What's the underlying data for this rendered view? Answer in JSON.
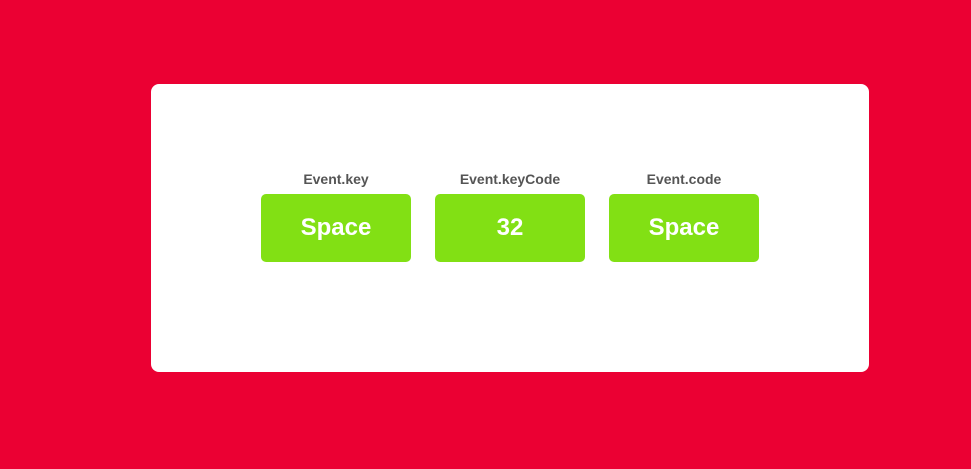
{
  "colors": {
    "background": "#eb0033",
    "card": "#ffffff",
    "key_box": "#82e014",
    "label_text": "#555555",
    "value_text": "#ffffff"
  },
  "keys": [
    {
      "label": "Event.key",
      "value": "Space"
    },
    {
      "label": "Event.keyCode",
      "value": "32"
    },
    {
      "label": "Event.code",
      "value": "Space"
    }
  ]
}
